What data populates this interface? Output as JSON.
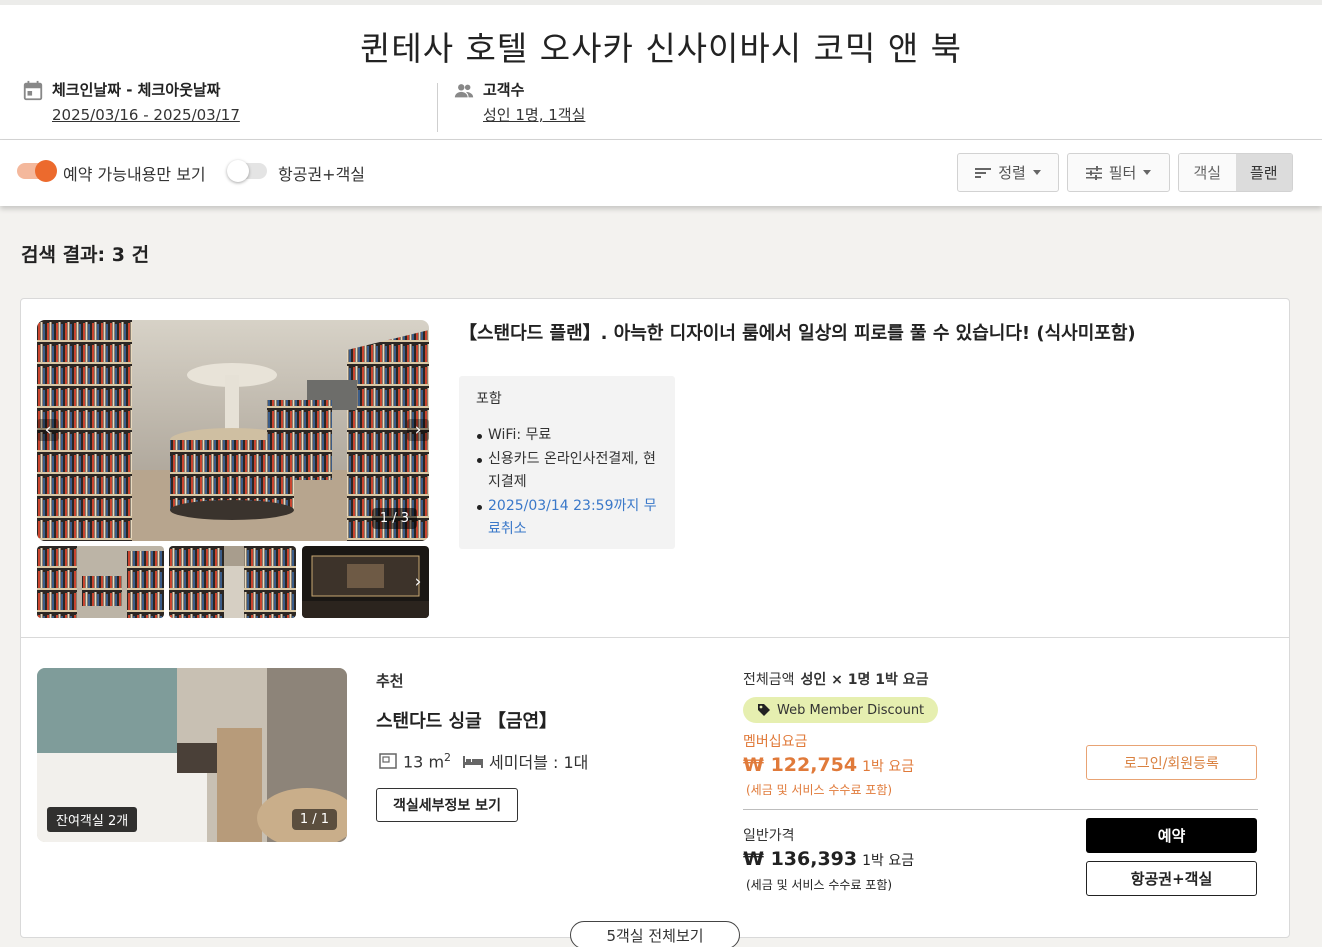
{
  "hotel": {
    "name": "퀸테사 호텔 오사카 신사이바시 코믹 앤 북"
  },
  "search": {
    "dates_label": "체크인날짜 - 체크아웃날짜",
    "dates_value": "2025/03/16 - 2025/03/17",
    "guests_label": "고객수",
    "guests_value": "성인 1명, 1객실"
  },
  "toolbar": {
    "available_only_label": "예약 가능내용만 보기",
    "available_only_on": true,
    "air_hotel_label": "항공권+객실",
    "air_hotel_on": false,
    "sort_label": "정렬",
    "filter_label": "필터",
    "view_room": "객실",
    "view_plan": "플랜",
    "active_view": "플랜"
  },
  "results": {
    "label": "검색 결과: 3 건"
  },
  "plan": {
    "title": "【스탠다드 플랜】. 아늑한 디자이너 룸에서 일상의 피로를 풀 수 있습니다! (식사미포함)",
    "photo_counter": "1 / 3",
    "includes_title": "포함",
    "includes": [
      "WiFi: 무료",
      "신용카드 온라인사전결제, 현지결제",
      "2025/03/14 23:59까지 무료취소"
    ]
  },
  "room": {
    "recommend": "추천",
    "name": "스탠다드 싱글 【금연】",
    "size_num": "13 m",
    "size_sup": "2",
    "bed": "세미더블 : 1대",
    "detail_button": "객실세부정보 보기",
    "remaining": "잔여객실 2개",
    "photo_counter": "1 / 1"
  },
  "pricing": {
    "total_label": "전체금액",
    "total_detail": "성인 × 1명 1박 요금",
    "discount_chip": "Web Member Discount",
    "member_label": "멤버십요금",
    "member_price": "₩ 122,754",
    "member_unit": "1박 요금",
    "member_tax": "(세금 및 서비스 수수료 포함)",
    "normal_label": "일반가격",
    "normal_price": "₩ 136,393",
    "normal_unit": "1박 요금",
    "normal_tax": "(세금 및 서비스 수수료 포함)",
    "login_button": "로그인/회원등록",
    "reserve_button": "예약",
    "air_hotel_button": "항공권+객실"
  },
  "view_all": "5객실 전체보기",
  "colors": {
    "accent": "#ec6a2d",
    "member_price": "#e07a3a",
    "link_blue": "#3a78c9",
    "chip": "#e6efb0"
  }
}
